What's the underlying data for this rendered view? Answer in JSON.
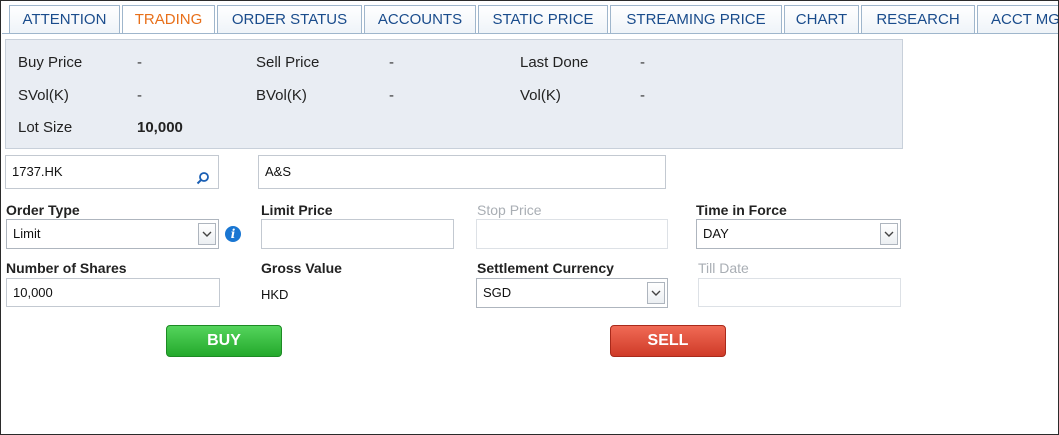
{
  "tabs": [
    {
      "label": "ATTENTION"
    },
    {
      "label": "TRADING"
    },
    {
      "label": "ORDER STATUS"
    },
    {
      "label": "ACCOUNTS"
    },
    {
      "label": "STATIC PRICE"
    },
    {
      "label": "STREAMING PRICE"
    },
    {
      "label": "CHART"
    },
    {
      "label": "RESEARCH"
    },
    {
      "label": "ACCT MG"
    }
  ],
  "active_tab": "TRADING",
  "quote": {
    "buy_price_label": "Buy Price",
    "buy_price": "-",
    "sell_price_label": "Sell Price",
    "sell_price": "-",
    "last_done_label": "Last Done",
    "last_done": "-",
    "svol_label": "SVol(K)",
    "svol": "-",
    "bvol_label": "BVol(K)",
    "bvol": "-",
    "vol_label": "Vol(K)",
    "vol": "-",
    "lot_size_label": "Lot Size",
    "lot_size": "10,000"
  },
  "symbol": {
    "code": "1737.HK",
    "name": "A&S"
  },
  "order": {
    "order_type_label": "Order Type",
    "order_type": "Limit",
    "limit_price_label": "Limit Price",
    "limit_price": "",
    "stop_price_label": "Stop Price",
    "stop_price": "",
    "time_in_force_label": "Time in Force",
    "time_in_force": "DAY",
    "shares_label": "Number of Shares",
    "shares": "10,000",
    "gross_value_label": "Gross Value",
    "gross_value": "HKD",
    "settlement_label": "Settlement Currency",
    "settlement": "SGD",
    "till_date_label": "Till Date",
    "till_date": ""
  },
  "buttons": {
    "buy": "BUY",
    "sell": "SELL"
  },
  "colors": {
    "tab_text": "#1a4c8c",
    "active_tab": "#e8701a",
    "buy": "#2fb536",
    "sell": "#e04a36",
    "info": "#1976d2"
  }
}
